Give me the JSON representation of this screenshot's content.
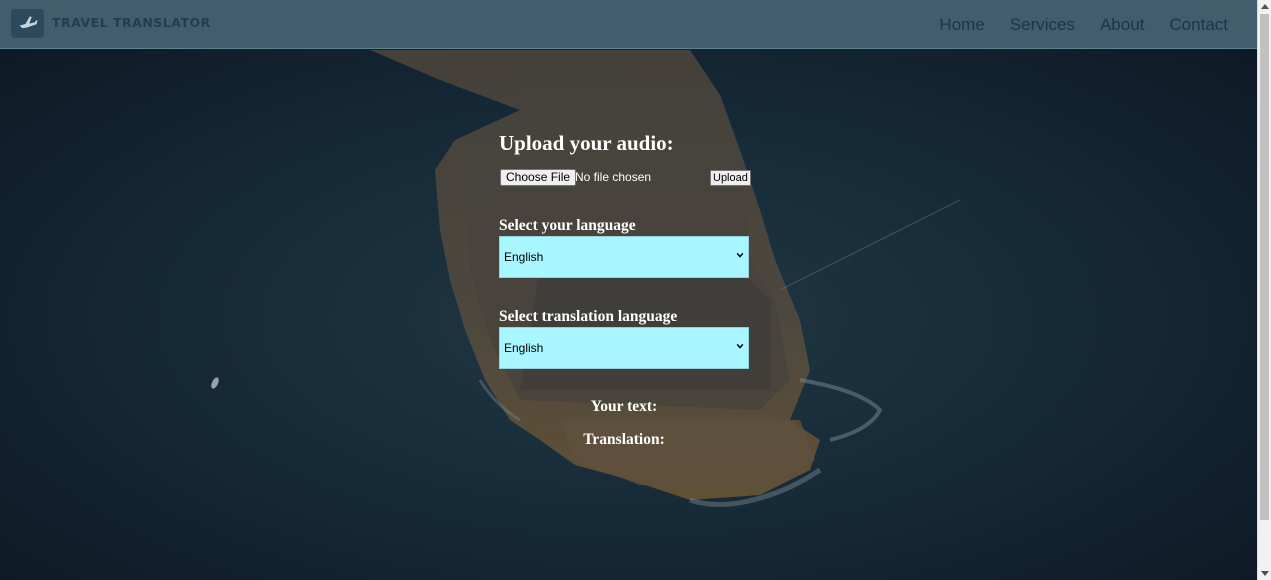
{
  "navbar": {
    "brand": "TRAVEL TRANSLATOR",
    "logo_icon": "airplane-icon",
    "links": [
      "Home",
      "Services",
      "About",
      "Contact"
    ]
  },
  "form": {
    "upload_heading": "Upload your audio:",
    "choose_file_label": "Choose File",
    "no_file_text": "No file chosen",
    "upload_button_label": "Upload",
    "source_language_label": "Select your language",
    "source_language_value": "English",
    "target_language_label": "Select translation language",
    "target_language_value": "English",
    "your_text_label": "Your text:",
    "translation_label": "Translation:"
  },
  "colors": {
    "navbar": "#466474",
    "select_bg": "#a8f6ff",
    "nav_text": "#1e3542"
  }
}
